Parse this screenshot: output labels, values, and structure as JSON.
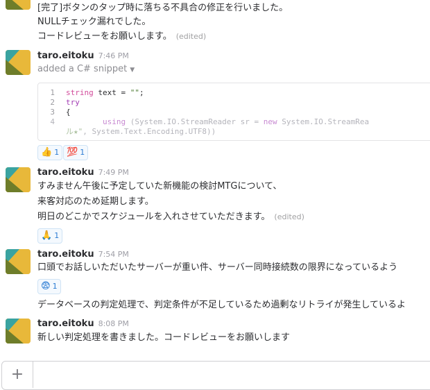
{
  "messages": [
    {
      "lines": [
        "[完了]ボタンのタップ時に落ちる不具合の修正を行いました。",
        "NULLチェック漏れでした。",
        "コードレビューをお願いします。"
      ],
      "edited": "(edited)"
    },
    {
      "author": "taro.eitoku",
      "time": "7:46 PM",
      "snippet_note": "added a C# snippet",
      "code": [
        {
          "num": "1",
          "text": "string text = \"\";"
        },
        {
          "num": "2",
          "text": "try"
        },
        {
          "num": "3",
          "text": "{"
        },
        {
          "num": "4",
          "text": "        using (System.IO.StreamReader sr = new System.IO.StreamRea"
        },
        {
          "num": "",
          "text": "ル★\", System.Text.Encoding.UTF8))"
        }
      ],
      "reactions": [
        {
          "emoji": "👍",
          "count": "1"
        },
        {
          "emoji": "💯",
          "count": "1"
        }
      ]
    },
    {
      "author": "taro.eitoku",
      "time": "7:49 PM",
      "lines": [
        "すみません午後に予定していた新機能の検討MTGについて、",
        "来客対応のため延期します。",
        "明日のどこかでスケジュールを入れさせていただきます。"
      ],
      "edited": "(edited)",
      "reactions": [
        {
          "emoji": "🙏",
          "count": "1"
        }
      ]
    },
    {
      "author": "taro.eitoku",
      "time": "7:54 PM",
      "lines": [
        "口頭でお話しいただいたサーバーが重い件、サーバー同時接続数の限界になっているよう",
        "データベースの判定処理で、判定条件が不足しているため過剰なリトライが発生しているよ"
      ],
      "reactions": [
        {
          "emoji": "😨",
          "count": "1"
        }
      ]
    },
    {
      "author": "taro.eitoku",
      "time": "8:08 PM",
      "lines": [
        "新しい判定処理を書きました。コードレビューをお願いします"
      ]
    }
  ],
  "composer": {
    "plus_label": "+",
    "placeholder": ""
  },
  "colors": {
    "avatar_teal": "#3aa3a0",
    "avatar_olive": "#6e7d2a",
    "avatar_gold": "#e8b83a",
    "reaction_blue": "#2b7bd3"
  }
}
